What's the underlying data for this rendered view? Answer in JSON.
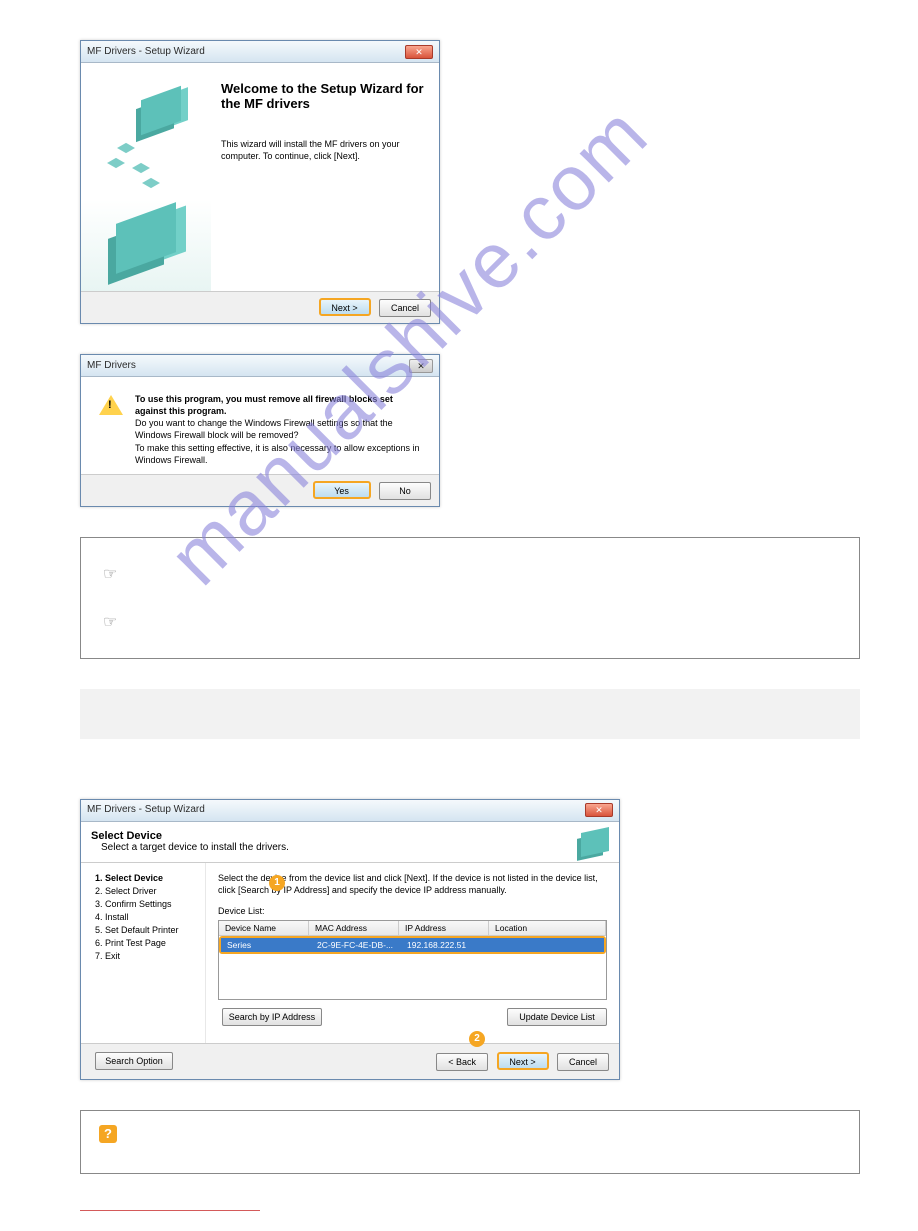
{
  "watermark": "manualshive.com",
  "dialog1": {
    "title": "MF Drivers - Setup Wizard",
    "heading": "Welcome to the Setup Wizard for the MF drivers",
    "body": "This wizard will install the MF drivers on your computer. To continue, click [Next].",
    "next": "Next >",
    "cancel": "Cancel"
  },
  "dialog2": {
    "title": "MF Drivers",
    "msg_bold": "To use this program, you must remove all firewall blocks set against this program.",
    "msg_rest": "Do you want to change the Windows Firewall settings so that the Windows Firewall block will be removed?\nTo make this setting effective, it is also necessary to allow exceptions in Windows Firewall.",
    "yes": "Yes",
    "no": "No"
  },
  "dialog3": {
    "title": "MF Drivers - Setup Wizard",
    "heading": "Select Device",
    "sub": "Select a target device to install the drivers.",
    "steps": [
      "Select Device",
      "Select Driver",
      "Confirm Settings",
      "Install",
      "Set Default Printer",
      "Print Test Page",
      "Exit"
    ],
    "instruction": "Select the device from the device list and click [Next]. If the device is not listed in the device list, click [Search by IP Address] and specify the device IP address manually.",
    "list_label": "Device List:",
    "cols": {
      "name": "Device Name",
      "mac": "MAC Address",
      "ip": "IP Address",
      "loc": "Location"
    },
    "row": {
      "name": "Series",
      "mac": "2C-9E-FC-4E-DB-...",
      "ip": "192.168.222.51",
      "loc": ""
    },
    "search_ip": "Search by IP Address",
    "update": "Update Device List",
    "search_opt": "Search Option",
    "back": "< Back",
    "next": "Next >",
    "cancel": "Cancel",
    "badge1": "1",
    "badge2": "2"
  }
}
